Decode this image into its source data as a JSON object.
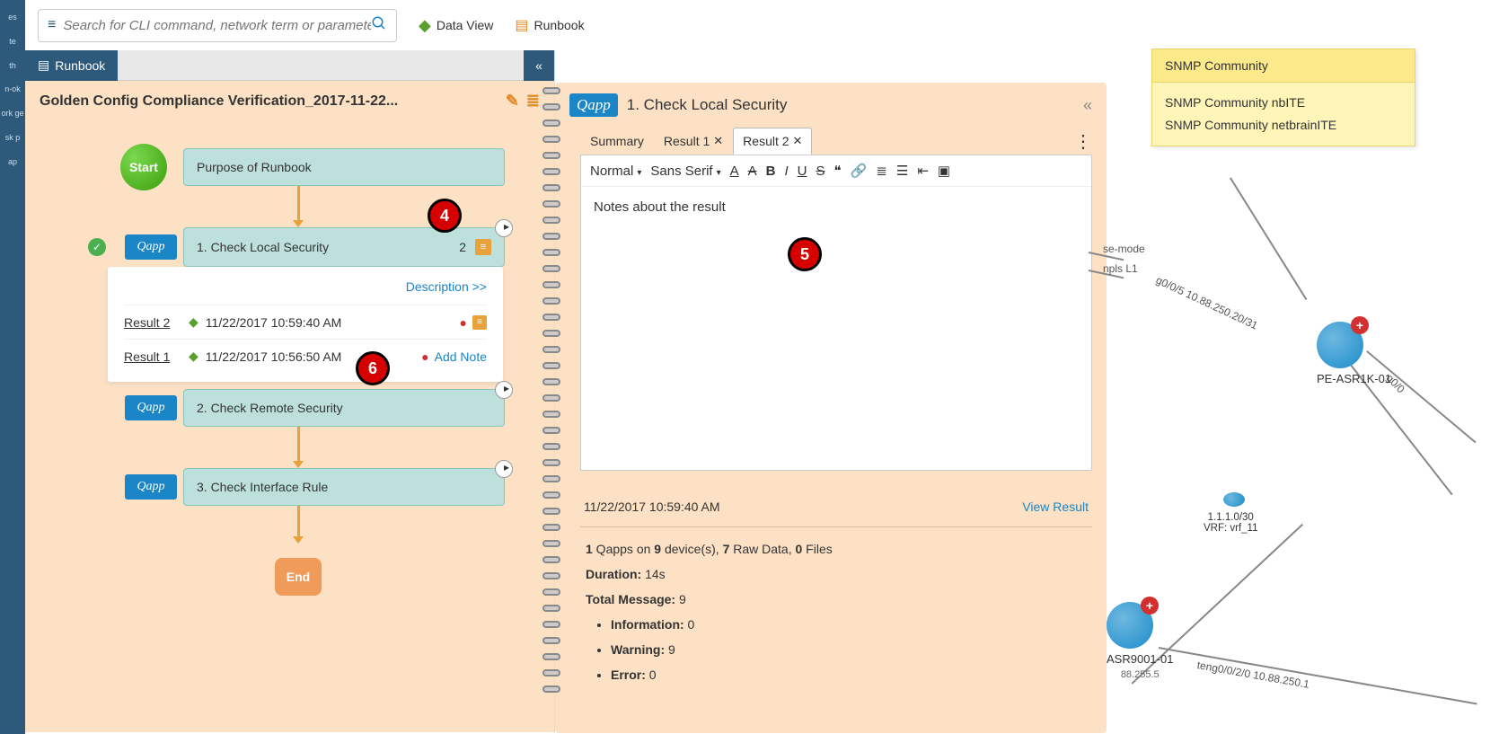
{
  "search": {
    "placeholder": "Search for CLI command, network term or parameter"
  },
  "topLinks": {
    "dataView": "Data View",
    "runbook": "Runbook"
  },
  "leftNav": {
    "items": [
      "es",
      "te",
      "th",
      "n-ok",
      "ork ge",
      "sk p",
      "ap"
    ]
  },
  "panelTab": "Runbook",
  "runbookTitle": "Golden Config Compliance Verification_2017-11-22...",
  "workflow": {
    "start": "Start",
    "purpose": "Purpose of Runbook",
    "step1": {
      "label": "1. Check Local Security",
      "count": "2"
    },
    "step2": {
      "label": "2. Check Remote Security"
    },
    "step3": {
      "label": "3. Check Interface Rule"
    },
    "end": "End",
    "descLink": "Description >>",
    "results": [
      {
        "name": "Result 2",
        "ts": "11/22/2017 10:59:40 AM"
      },
      {
        "name": "Result 1",
        "ts": "11/22/2017 10:56:50 AM"
      }
    ],
    "addNote": "Add Note"
  },
  "notes": {
    "title": "1. Check Local Security",
    "tabs": {
      "summary": "Summary",
      "r1": "Result 1",
      "r2": "Result 2"
    },
    "toolbar": {
      "normal": "Normal",
      "font": "Sans Serif"
    },
    "content": "Notes about the result",
    "summary": {
      "timestamp": "11/22/2017 10:59:40 AM",
      "viewResult": "View Result",
      "line1_a": "1",
      "line1_b": " Qapps on ",
      "line1_c": "9",
      "line1_d": " device(s), ",
      "line1_e": "7",
      "line1_f": " Raw Data, ",
      "line1_g": "0",
      "line1_h": " Files",
      "durationLabel": "Duration: ",
      "duration": "14s",
      "totalLabel": "Total Message: ",
      "total": "9",
      "infoLabel": "Information: ",
      "info": "0",
      "warnLabel": "Warning: ",
      "warn": "9",
      "errLabel": "Error: ",
      "err": "0"
    }
  },
  "map": {
    "sticky": {
      "title": "SNMP Community",
      "line1": "SNMP Community nbITE",
      "line2": "SNMP Community netbrainITE"
    },
    "dev1": "PE-ASR1K-01",
    "dev2": "ASR9001-01",
    "sub2": "88.255.5",
    "net": "1.1.1.0/30",
    "vrf": "VRF: vrf_11",
    "lnk1": "g0/0/5 10.88.250.20/31",
    "lnk2": "teng0/0/2/0 10.88.250.1",
    "ed1": "se-mode",
    "ed2": "npls L1",
    "ed3": "g0/0"
  },
  "callouts": {
    "c4": "4",
    "c5": "5",
    "c6": "6"
  }
}
